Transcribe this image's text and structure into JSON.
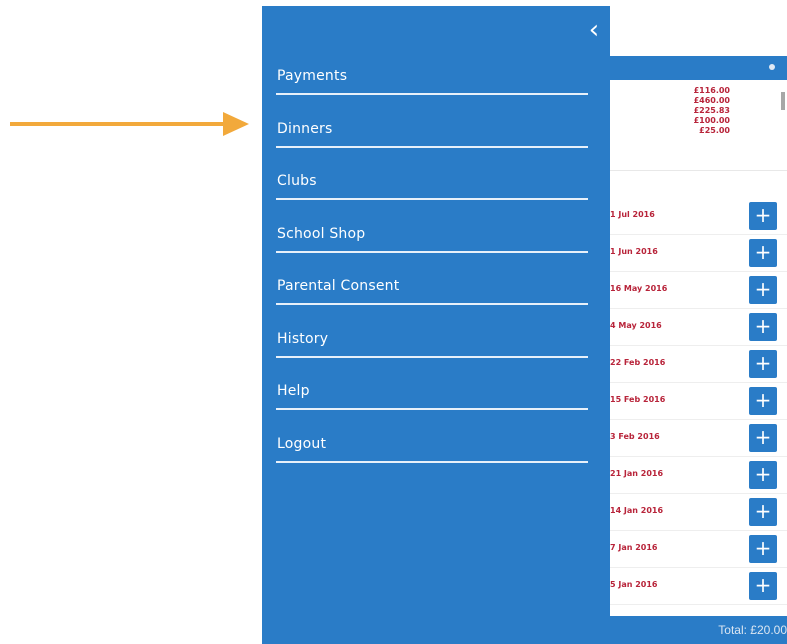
{
  "menu": {
    "items": [
      {
        "label": "Payments"
      },
      {
        "label": "Dinners"
      },
      {
        "label": "Clubs"
      },
      {
        "label": "School Shop"
      },
      {
        "label": "Parental Consent"
      },
      {
        "label": "History"
      },
      {
        "label": "Help"
      },
      {
        "label": "Logout"
      }
    ],
    "back_icon": "chevron-left-icon"
  },
  "background": {
    "amounts": [
      "£116.00",
      "£460.00",
      "£225.83",
      "£100.00",
      "£25.00"
    ],
    "dates": [
      "1 Jul 2016",
      "1 Jun 2016",
      "16 May 2016",
      "4 May 2016",
      "22 Feb 2016",
      "15 Feb 2016",
      "3 Feb 2016",
      "21 Jan 2016",
      "14 Jan 2016",
      "7 Jan 2016",
      "5 Jan 2016"
    ],
    "add_symbol": "+",
    "total": "Total: £20.00"
  },
  "colors": {
    "drawer": "#2a7cc7",
    "arrow": "#f2a93b",
    "amount_text": "#b8243a"
  }
}
